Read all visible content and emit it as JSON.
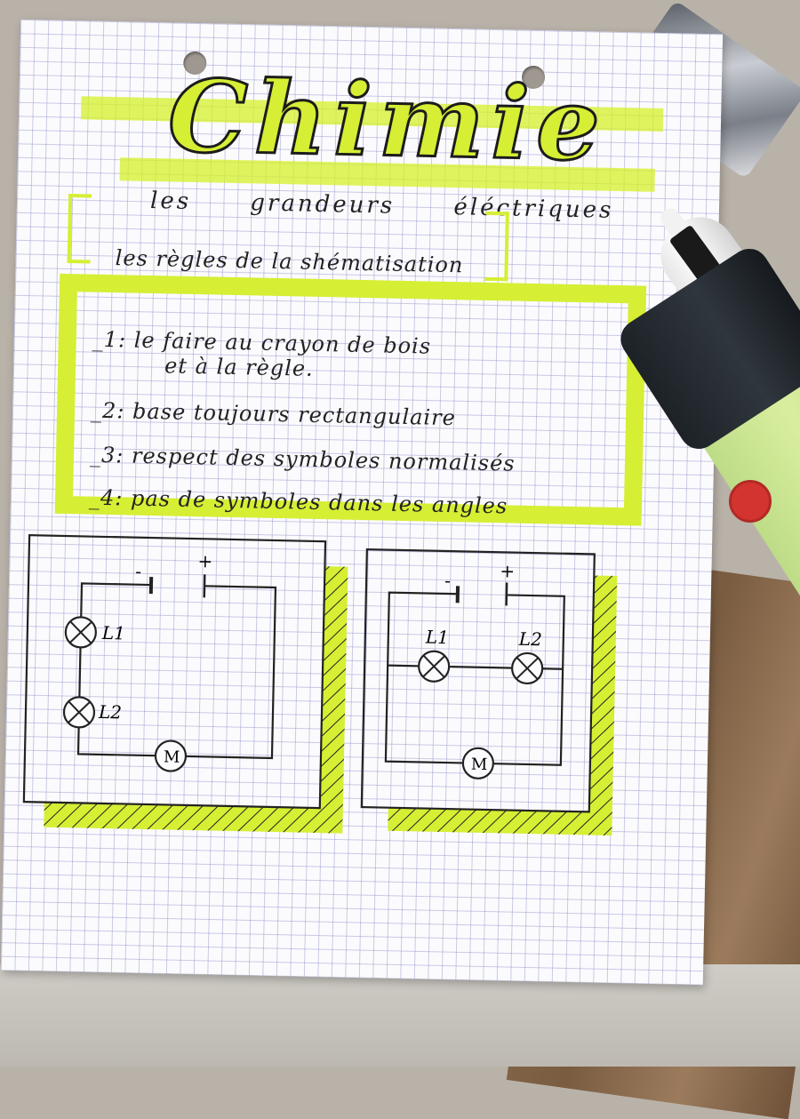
{
  "page": {
    "title": "Chimie",
    "subtitle": "les grandeurs éléctriques",
    "rules_heading": "les règles de la shématisation",
    "rules": [
      {
        "text": "_1: le faire au crayon de bois"
      },
      {
        "text": "et à la règle."
      },
      {
        "text": "_2: base toujours rectangulaire"
      },
      {
        "text": "_3: respect des symboles normalisés"
      },
      {
        "text": "_4: pas de symboles dans les angles"
      }
    ],
    "circuits": [
      {
        "layout": "series",
        "minus": "-",
        "plus": "+",
        "lamp1": "L1",
        "lamp2": "L2",
        "motor": "M"
      },
      {
        "layout": "parallel",
        "minus": "-",
        "plus": "+",
        "lamp1": "L1",
        "lamp2": "L2",
        "motor": "M"
      }
    ]
  },
  "colors": {
    "highlighter": "#d6ee34",
    "ink": "#222222",
    "grid": "#8c8cc8",
    "paper": "#fbfbfd"
  },
  "objects": [
    "four-color-pen",
    "green-highlighter-marker"
  ]
}
